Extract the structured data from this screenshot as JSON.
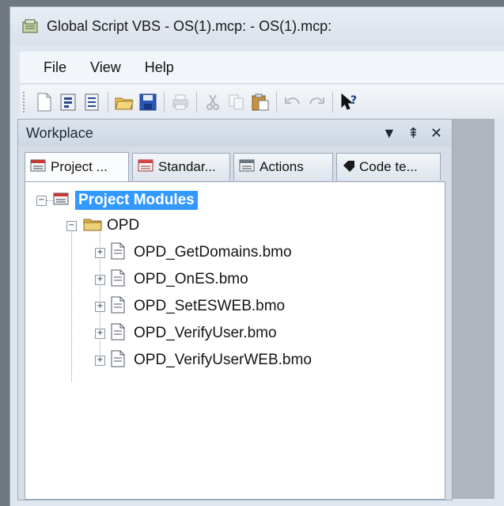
{
  "window": {
    "title": "Global Script VBS - OS(1).mcp: - OS(1).mcp:"
  },
  "menu": {
    "items": [
      "File",
      "View",
      "Help"
    ]
  },
  "toolbar": {
    "buttons": [
      "new-icon",
      "open-module-icon",
      "new-project-icon",
      "open-folder-icon",
      "save-icon",
      "print-icon",
      "cut-icon",
      "copy-icon",
      "paste-icon",
      "undo-icon",
      "redo-icon",
      "context-help-icon"
    ]
  },
  "workplace": {
    "title": "Workplace",
    "controls": {
      "dropdown": "▼",
      "pin": "⇞",
      "close": "✕"
    },
    "tabs": [
      "Project ...",
      "Standar...",
      "Actions",
      "Code te..."
    ]
  },
  "tree": {
    "root": "Project Modules",
    "folder": "OPD",
    "items": [
      "OPD_GetDomains.bmo",
      "OPD_OnES.bmo",
      "OPD_SetESWEB.bmo",
      "OPD_VerifyUser.bmo",
      "OPD_VerifyUserWEB.bmo"
    ]
  },
  "colors": {
    "selection": "#3399ff",
    "panel_bg": "#d6dde7",
    "accent_save": "#2b57b8"
  }
}
